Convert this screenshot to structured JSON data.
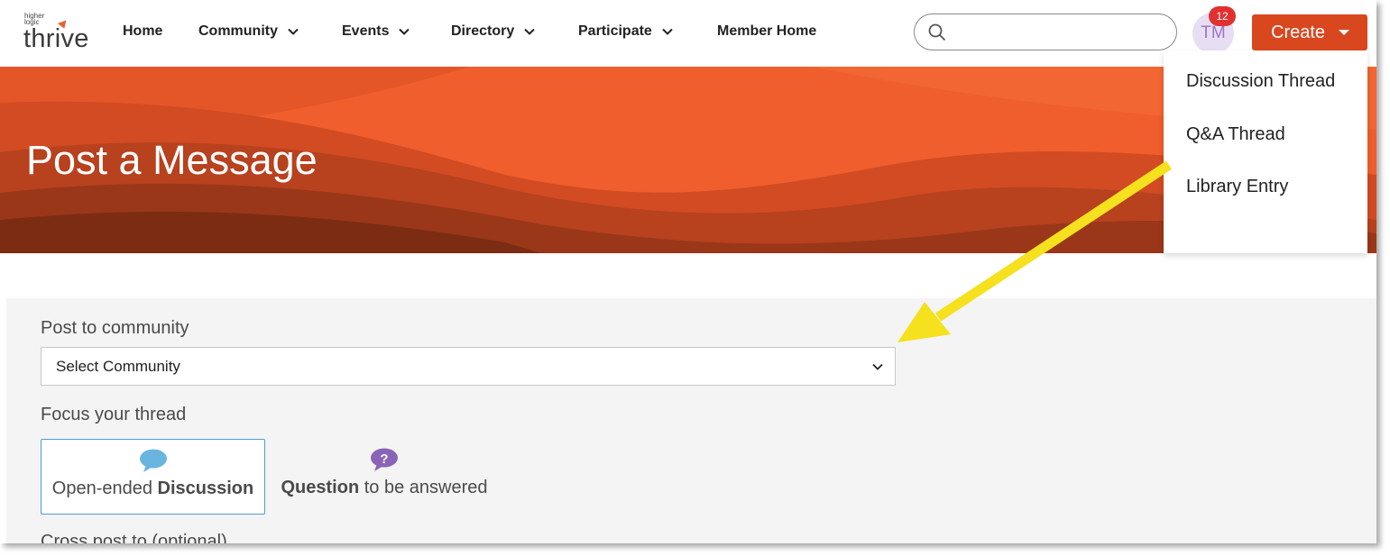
{
  "logo": {
    "small": "higher logic",
    "big": "thrive"
  },
  "nav": [
    {
      "label": "Home",
      "dropdown": false
    },
    {
      "label": "Community",
      "dropdown": true
    },
    {
      "label": "Events",
      "dropdown": true
    },
    {
      "label": "Directory",
      "dropdown": true
    },
    {
      "label": "Participate",
      "dropdown": true
    },
    {
      "label": "Member Home",
      "dropdown": false
    }
  ],
  "search": {
    "placeholder": "",
    "value": ""
  },
  "user": {
    "initials": "TM",
    "notification_count": "12"
  },
  "create_button": {
    "label": "Create"
  },
  "create_menu": {
    "items": [
      "Discussion Thread",
      "Q&A Thread",
      "Library Entry"
    ]
  },
  "banner": {
    "title": "Post a Message"
  },
  "form": {
    "community_label": "Post to community",
    "community_select_value": "Select Community",
    "focus_label": "Focus your thread",
    "focus_options": [
      {
        "prefix": "Open-ended ",
        "bold": "Discussion",
        "suffix": "",
        "selected": true,
        "icon": "speech-bubble-icon"
      },
      {
        "prefix": "",
        "bold": "Question",
        "suffix": " to be answered",
        "selected": false,
        "icon": "question-bubble-icon"
      }
    ],
    "crosspost_label": "Cross post to (optional)"
  },
  "colors": {
    "brand": "#d9471f",
    "annotation_arrow": "#f5e11e",
    "selected_border": "#4d9cd6"
  }
}
